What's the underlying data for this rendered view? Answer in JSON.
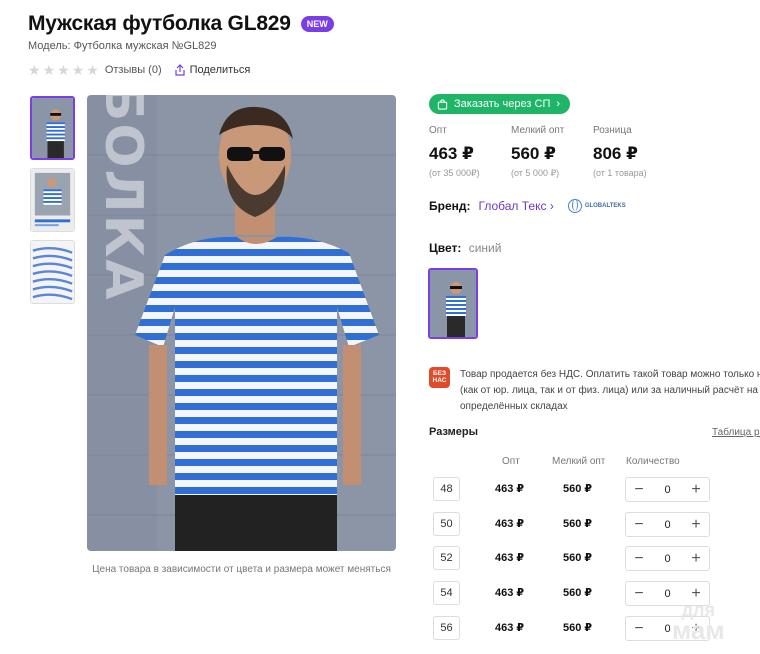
{
  "product": {
    "title": "Мужская футболка GL829",
    "badge": "NEW",
    "model": "Модель: Футболка мужская №GL829"
  },
  "rating": {
    "stars_filled": 0,
    "stars_total": 5,
    "reviews_label": "Отзывы (0)",
    "share_label": "Поделиться"
  },
  "gallery": {
    "caption": "Цена товара в зависимости от цвета и размера может меняться",
    "thumbnails": [
      "photo-front",
      "photo-front-small",
      "fabric-closeup"
    ],
    "active_thumbnail": 0,
    "main_image_text": "ФУТБОЛКА"
  },
  "order_button": {
    "label": "Заказать через СП"
  },
  "prices": [
    {
      "label": "Опт",
      "value": "463 ₽",
      "sub": "(от 35 000₽)"
    },
    {
      "label": "Мелкий опт",
      "value": "560 ₽",
      "sub": "(от 5 000 ₽)"
    },
    {
      "label": "Розница",
      "value": "806 ₽",
      "sub": "(от 1 товара)"
    }
  ],
  "brand": {
    "label": "Бренд:",
    "name": "Глобал Текс",
    "logo_text": "GLOBALTEKS"
  },
  "color": {
    "label": "Цвет:",
    "value": "синий"
  },
  "vat": {
    "icon_text": "БЕЗ НАС",
    "text": "Товар продается без НДС. Оплатить такой товар можно только н\n(как от юр. лица, так и от физ. лица) или за наличный расчёт на\nопределённых складах"
  },
  "sizes": {
    "title": "Размеры",
    "table_link": "Таблица ра",
    "headers": {
      "opt": "Опт",
      "small_opt": "Мелкий опт",
      "quantity": "Количество"
    },
    "rows": [
      {
        "size": "48",
        "opt": "463 ₽",
        "small_opt": "560 ₽",
        "qty": "0"
      },
      {
        "size": "50",
        "opt": "463 ₽",
        "small_opt": "560 ₽",
        "qty": "0"
      },
      {
        "size": "52",
        "opt": "463 ₽",
        "small_opt": "560 ₽",
        "qty": "0"
      },
      {
        "size": "54",
        "opt": "463 ₽",
        "small_opt": "560 ₽",
        "qty": "0"
      },
      {
        "size": "56",
        "opt": "463 ₽",
        "small_opt": "560 ₽",
        "qty": "0"
      }
    ]
  },
  "watermark": {
    "line1": "для",
    "line2": "мам"
  },
  "colors": {
    "accent": "#7a3ee6",
    "order_green": "#1fb567",
    "link_purple": "#6a39c9",
    "stripe_blue": "#2f6fd6"
  }
}
